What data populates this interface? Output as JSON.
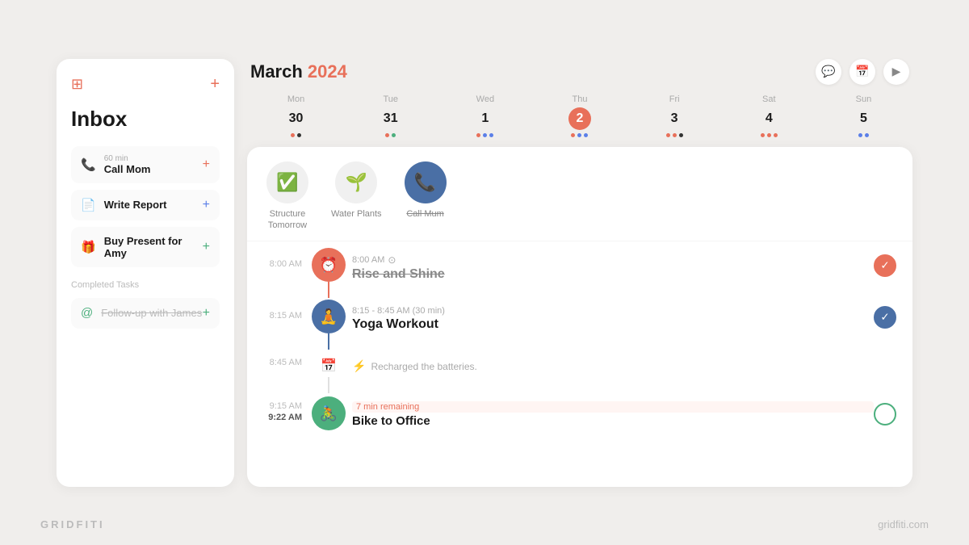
{
  "brand": {
    "left": "GRIDFITI",
    "right": "gridfiti.com"
  },
  "sidebar": {
    "title": "Inbox",
    "add_label": "+",
    "tasks": [
      {
        "id": "call-mom",
        "icon": "phone",
        "duration": "60 min",
        "name": "Call Mom"
      },
      {
        "id": "write-report",
        "icon": "doc",
        "duration": "",
        "name": "Write Report"
      },
      {
        "id": "buy-present",
        "icon": "gift",
        "duration": "",
        "name": "Buy Present for Amy"
      }
    ],
    "completed_label": "Completed Tasks",
    "completed_tasks": [
      {
        "id": "follow-up",
        "icon": "at",
        "name": "Follow-up with James"
      }
    ]
  },
  "calendar": {
    "title": "March",
    "year": "2024",
    "header_icons": [
      "chat",
      "calendar",
      "play"
    ],
    "days": [
      {
        "label": "Mon",
        "number": "30",
        "dots": [
          "pink",
          "black"
        ]
      },
      {
        "label": "Tue",
        "number": "31",
        "dots": [
          "pink",
          "green"
        ]
      },
      {
        "label": "Wed",
        "number": "1",
        "dots": [
          "pink",
          "blue",
          "blue"
        ]
      },
      {
        "label": "Thu",
        "number": "2",
        "today": true,
        "dots": [
          "pink",
          "blue",
          "blue"
        ]
      },
      {
        "label": "Fri",
        "number": "3",
        "dots": [
          "pink",
          "pink",
          "black"
        ]
      },
      {
        "label": "Sat",
        "number": "4",
        "dots": [
          "pink",
          "pink",
          "pink"
        ]
      },
      {
        "label": "Sun",
        "number": "5",
        "dots": [
          "blue",
          "blue"
        ]
      }
    ]
  },
  "quick_tasks": [
    {
      "id": "structure-tomorrow",
      "emoji": "✅",
      "label": "Structure\nTomorrow",
      "style": "light"
    },
    {
      "id": "water-plants",
      "emoji": "🌱",
      "label": "Water Plants",
      "style": "light"
    },
    {
      "id": "call-mum",
      "emoji": "📞",
      "label": "Call Mum",
      "style": "dark-blue",
      "strikethrough": true
    }
  ],
  "timeline": [
    {
      "id": "rise-shine",
      "time": "8:00 AM",
      "event_time": "8:00 AM",
      "title": "Rise and Shine",
      "strikethrough": true,
      "circle_color": "pink",
      "icon": "⏰",
      "check": "checked-pink",
      "has_clock_icon": true
    },
    {
      "id": "yoga-workout",
      "time": "8:15 AM",
      "event_time": "8:15 - 8:45 AM (30 min)",
      "title": "Yoga Workout",
      "strikethrough": false,
      "circle_color": "slate",
      "icon": "🧘",
      "check": "checked-blue",
      "has_clock_icon": false
    },
    {
      "id": "yoga-note",
      "time": "8:45 AM",
      "is_note": true,
      "note_icon": "📅",
      "note_text": "Recharged the batteries.",
      "circle_color": "slate"
    },
    {
      "id": "bike-office",
      "time": "9:15 AM",
      "time2": "9:22 AM",
      "event_badge": "7 min remaining",
      "title": "Bike to Office",
      "strikethrough": false,
      "circle_color": "green",
      "icon": "🚴",
      "check": "empty"
    }
  ]
}
